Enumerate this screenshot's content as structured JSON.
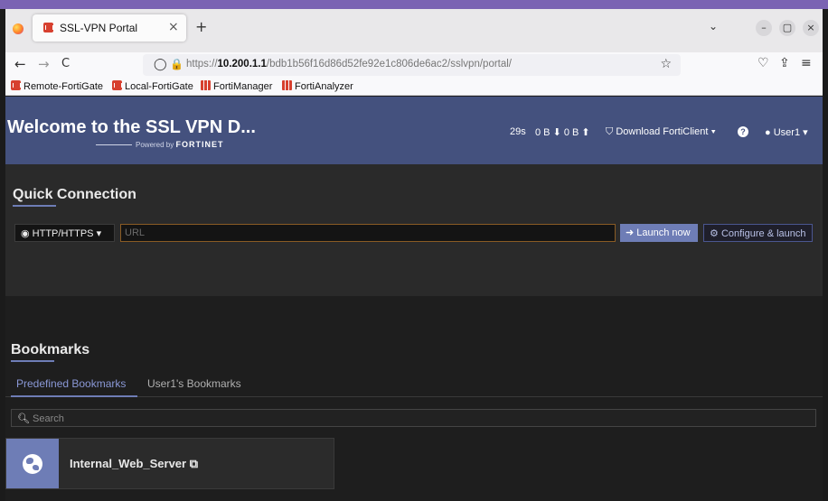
{
  "browser": {
    "tab_title": "SSL-VPN Portal",
    "tab_close": "×",
    "new_tab": "+",
    "tab_list": "⌄",
    "window_controls": {
      "minimize": "–",
      "restore": "▢",
      "close": "×"
    },
    "nav": {
      "back": "←",
      "forward": "→",
      "reload": "C"
    },
    "url_prefix": "https://",
    "url_host": "10.200.1.1",
    "url_path": "/bdb1b56f16d86d52fe92e1c806de6ac2/sslvpn/portal/",
    "bookmarks_bar": [
      "Remote-FortiGate",
      "Local-FortiGate",
      "FortiManager",
      "FortiAnalyzer"
    ]
  },
  "header": {
    "title": "Welcome to the SSL VPN D...",
    "powered_by": "Powered by",
    "brand": "FORTINET",
    "session_time": "29s",
    "traffic": "0 B ⬇ 0 B ⬆",
    "download_label": "Download FortiClient ▾",
    "help": "?",
    "user_label": "User1 ▾"
  },
  "quick_connection": {
    "title": "Quick Connection",
    "protocol": "HTTP/HTTPS",
    "url_placeholder": "URL",
    "launch_label": "Launch now",
    "configure_label": "Configure & launch"
  },
  "bookmarks": {
    "title": "Bookmarks",
    "tabs": [
      "Predefined Bookmarks",
      "User1's Bookmarks"
    ],
    "search_placeholder": "Search",
    "items": [
      {
        "label": "Internal_Web_Server"
      }
    ]
  },
  "colors": {
    "header_bg": "#44517e",
    "accent": "#6e7db6",
    "panel_bg": "#2a2a2a",
    "input_focus_border": "#8a5b24"
  }
}
